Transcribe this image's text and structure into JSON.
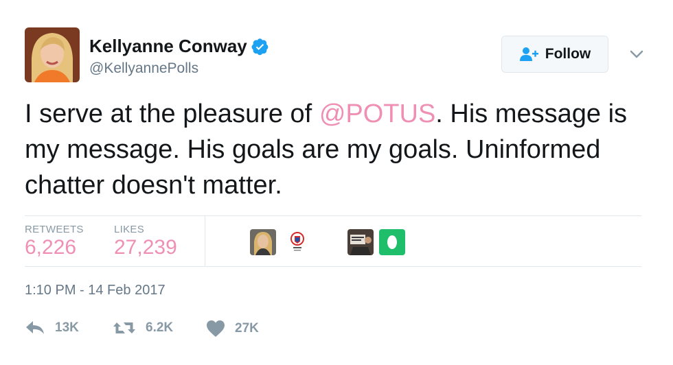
{
  "author": {
    "name": "Kellyanne Conway",
    "handle": "@KellyannePolls",
    "verified": true
  },
  "follow_label": "Follow",
  "tweet": {
    "text_before": "I serve at the pleasure of ",
    "mention": "@POTUS",
    "text_after": ". His message is my message. His goals are my goals. Uninformed chatter doesn't matter."
  },
  "stats": {
    "retweets_label": "RETWEETS",
    "retweets_value": "6,226",
    "likes_label": "LIKES",
    "likes_value": "27,239"
  },
  "timestamp": "1:10 PM - 14 Feb 2017",
  "actions": {
    "reply_count": "13K",
    "retweet_count": "6.2K",
    "like_count": "27K"
  },
  "colors": {
    "accent_pink": "#ef8fb4",
    "muted": "#8899a6",
    "verified_blue": "#1da1f2"
  }
}
